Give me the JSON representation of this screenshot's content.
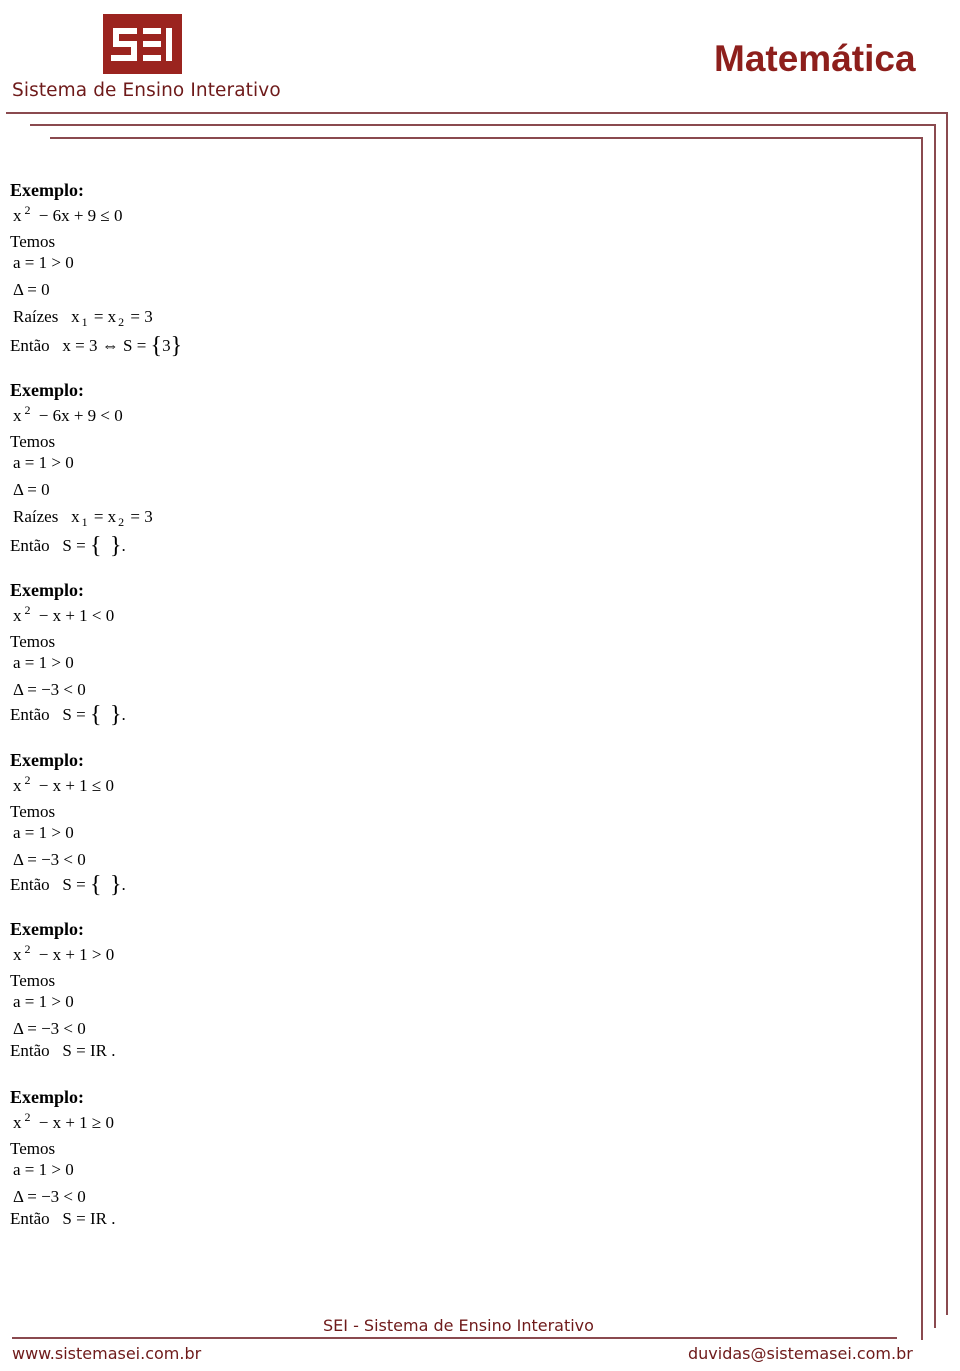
{
  "header": {
    "logo_text": "SEI",
    "brand_name": "Sistema de Ensino Interativo",
    "subject": "Matemática",
    "brand_color": "#9b241f",
    "line_color": "#8a4a4f"
  },
  "examples": [
    {
      "title": "Exemplo:",
      "inequality": {
        "base": "x",
        "exp": "2",
        "rest": " − 6x + 9 ≤ 0"
      },
      "temos": "Temos",
      "a_line": "a = 1 > 0",
      "delta_line": "Δ = 0",
      "roots": {
        "label": "Raízes",
        "x1": "x",
        "s1": "1",
        "mid": " = x",
        "s2": "2",
        "end": " = 3"
      },
      "conclusion": {
        "label": "Então",
        "pre": "x = 3 ⇔  S = ",
        "open": "{",
        "inner": "3",
        "close": "}",
        "post": ""
      }
    },
    {
      "title": "Exemplo:",
      "inequality": {
        "base": "x",
        "exp": "2",
        "rest": " − 6x + 9 < 0"
      },
      "temos": "Temos",
      "a_line": "a = 1 > 0",
      "delta_line": "Δ = 0",
      "roots": {
        "label": "Raízes",
        "x1": "x",
        "s1": "1",
        "mid": " = x",
        "s2": "2",
        "end": " = 3"
      },
      "conclusion": {
        "label": "Então",
        "pre": "S = ",
        "open": "{",
        "inner": "  ",
        "close": "}",
        "post": "."
      }
    },
    {
      "title": "Exemplo:",
      "inequality": {
        "base": "x",
        "exp": "2",
        "rest": " − x + 1 < 0"
      },
      "temos": "Temos",
      "a_line": "a = 1 > 0",
      "delta_line": "Δ = −3 < 0",
      "conclusion": {
        "label": "Então",
        "pre": "S = ",
        "open": "{",
        "inner": "  ",
        "close": "}",
        "post": "."
      }
    },
    {
      "title": "Exemplo:",
      "inequality": {
        "base": "x",
        "exp": "2",
        "rest": " − x + 1 ≤ 0"
      },
      "temos": "Temos",
      "a_line": "a = 1 > 0",
      "delta_line": "Δ = −3 < 0",
      "conclusion": {
        "label": "Então",
        "pre": "S = ",
        "open": "{",
        "inner": "  ",
        "close": "}",
        "post": "."
      }
    },
    {
      "title": "Exemplo:",
      "inequality": {
        "base": "x",
        "exp": "2",
        "rest": " − x + 1 > 0"
      },
      "temos": "Temos",
      "a_line": "a = 1 > 0",
      "delta_line": "Δ = −3 < 0",
      "conclusion": {
        "label": "Então",
        "pre": "S = IR .",
        "open": "",
        "inner": "",
        "close": "",
        "post": ""
      }
    },
    {
      "title": "Exemplo:",
      "inequality": {
        "base": "x",
        "exp": "2",
        "rest": " − x + 1 ≥ 0"
      },
      "temos": "Temos",
      "a_line": "a = 1 > 0",
      "delta_line": "Δ = −3 < 0",
      "conclusion": {
        "label": "Então",
        "pre": "S = IR .",
        "open": "",
        "inner": "",
        "close": "",
        "post": ""
      }
    }
  ],
  "footer": {
    "center": "SEI - Sistema de Ensino Interativo",
    "website": "www.sistemasei.com.br",
    "email": "duvidas@sistemasei.com.br"
  }
}
